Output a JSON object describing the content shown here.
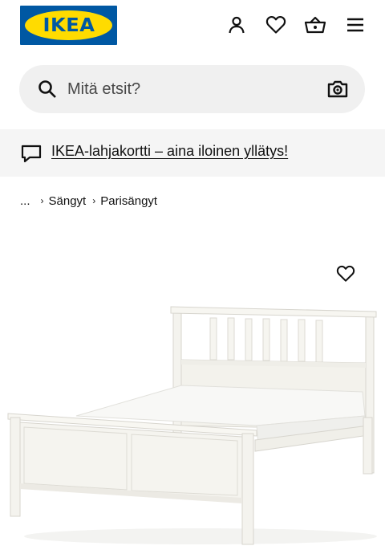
{
  "header": {
    "logo_text": "IKEA",
    "icons": [
      "user-icon",
      "heart-icon",
      "basket-icon",
      "menu-icon"
    ]
  },
  "search": {
    "placeholder": "Mitä etsit?",
    "icons": [
      "search-icon",
      "camera-icon"
    ]
  },
  "promo": {
    "text": "IKEA-lahjakortti – aina iloinen yllätys!",
    "icon": "chat-bubble-icon"
  },
  "breadcrumb": {
    "ellipsis": "...",
    "items": [
      "Sängyt",
      "Parisängyt"
    ]
  },
  "product": {
    "image_alt_icon": "bed-image",
    "favourite_icon": "heart-icon"
  },
  "colors": {
    "brand_blue": "#0058a3",
    "brand_yellow": "#ffdb00",
    "search_bg": "#f0f0f0",
    "promo_bg": "#f5f5f5",
    "text": "#111111"
  }
}
